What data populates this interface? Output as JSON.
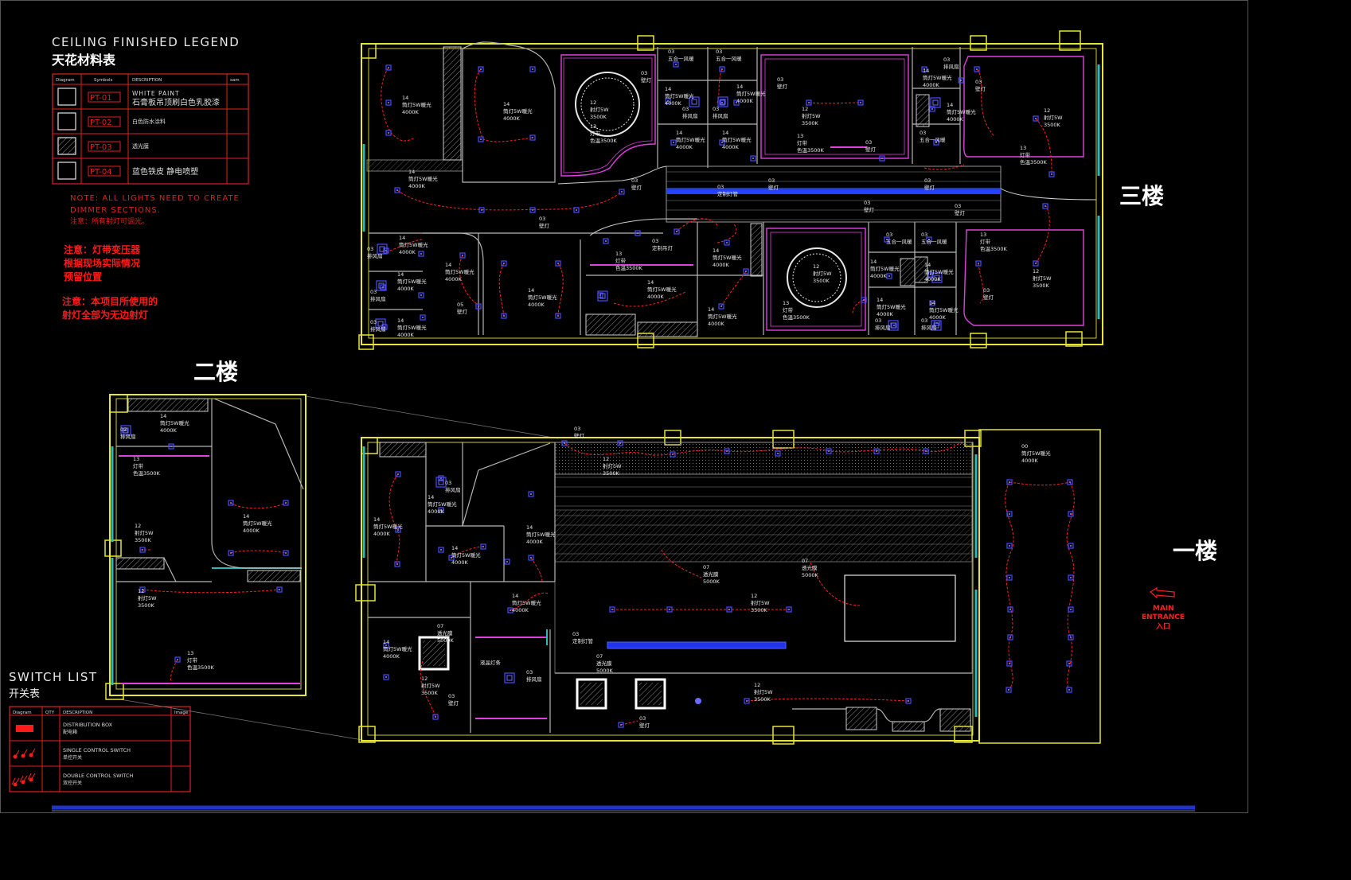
{
  "legend": {
    "title_en": "CEILING FINISHED LEGEND",
    "title_cn": "天花材料表",
    "headers": [
      "Diagram",
      "Symbols",
      "DESCRIPTION",
      "sam"
    ],
    "rows": [
      {
        "code": "PT-01",
        "desc1": "WHITE PAINT",
        "desc2": "石膏板吊顶刷白色乳胶漆",
        "hatched": false
      },
      {
        "code": "PT-02",
        "desc1": "",
        "desc2": "白色防水涂料",
        "hatched": false
      },
      {
        "code": "PT-03",
        "desc1": "",
        "desc2": "透光膜",
        "hatched": true
      },
      {
        "code": "PT-04",
        "desc1": "",
        "desc2": "蓝色铁皮 静电喷塑",
        "hatched": false
      }
    ],
    "note_en1": "NOTE: ALL LIGHTS NEED TO CREATE",
    "note_en2": "DIMMER SECTIONS.",
    "note_cn": "注意：所有射灯可调光。",
    "note2_line1": "注意：灯带变压器",
    "note2_line2": "根据现场实际情况",
    "note2_line3": "预留位置",
    "note3_line1": "注意：本项目所使用的",
    "note3_line2": "射灯全部为无边射灯"
  },
  "switch": {
    "title_en": "SWITCH LIST",
    "title_cn": "开关表",
    "headers": [
      "Diagram",
      "QTY",
      "DESCRIPTION",
      "Image"
    ],
    "rows": [
      {
        "desc": "DISTRIBUTION BOX",
        "cn": "配电箱"
      },
      {
        "desc": "SINGLE CONTROL SWITCH",
        "cn": "单控开关"
      },
      {
        "desc": "DOUBLE CONTROL SWITCH",
        "cn": "双控开关"
      }
    ]
  },
  "floors": {
    "third": "三楼",
    "second": "二楼",
    "first": "一楼"
  },
  "entrance": {
    "line1": "MAIN",
    "line2": "ENTRANCE",
    "line3": "入口"
  },
  "labels": {
    "l03": "03",
    "l12": "12",
    "l13": "13",
    "l14": "14",
    "l07": "07",
    "l05": "05",
    "l00": "00",
    "downlight_warm": "筒灯5W暖光",
    "k4000": "4000K",
    "k3500": "3500K",
    "k5000": "5000K",
    "spot5w": "射灯5W",
    "lightstrip": "灯带",
    "color3500": "色温3500K",
    "exhaust": "排风扇",
    "wallspot": "壁灯",
    "five_in_one": "五合一风暖",
    "custom_light": "定制吊灯",
    "translucent": "透光膜",
    "custom_tube": "定制灯管",
    "liquid_light": "液晶灯条"
  }
}
